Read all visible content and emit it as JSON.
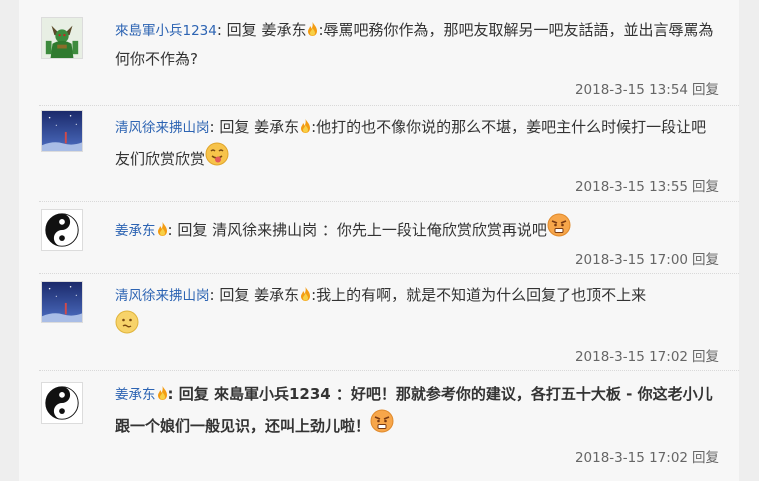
{
  "replies": [
    {
      "username": "來島軍小兵1234",
      "text_a": ": 回复 ",
      "target": "姜承东",
      "text_b": ":辱罵吧務你作為，那吧友取解另一吧友話語，並出言辱罵為何你不作為?",
      "time": "2018-3-15 13:54",
      "reply_label": "回复",
      "avatar_icon": "green-warrior-avatar",
      "emoji_icon": ""
    },
    {
      "username": "清风徐来拂山岗",
      "text_a": ": 回复 ",
      "target": "姜承东",
      "text_b": ":他打的也不像你说的那么不堪，姜吧主什么时候打一段让吧友们欣赏欣赏",
      "time": "2018-3-15 13:55",
      "reply_label": "回复",
      "avatar_icon": "night-sky-avatar",
      "emoji_icon": "tongue-emoji"
    },
    {
      "username": "姜承东",
      "text_a": ": 回复 ",
      "target": "清风徐来拂山岗",
      "text_b": " ：你先上一段让俺欣赏欣赏再说吧",
      "time": "2018-3-15 17:00",
      "reply_label": "回复",
      "avatar_icon": "yin-yang-avatar",
      "emoji_icon": "angry-emoji"
    },
    {
      "username": "清风徐来拂山岗",
      "text_a": ": 回复 ",
      "target": "姜承东",
      "text_b": ":我上的有啊，就是不知道为什么回复了也顶不上来",
      "time": "2018-3-15 17:02",
      "reply_label": "回复",
      "avatar_icon": "night-sky-avatar",
      "emoji_icon": "confused-emoji"
    },
    {
      "username": "姜承东",
      "text_a": ": 回复 ",
      "target": "來島軍小兵1234",
      "text_b": " ：好吧！那就参考你的建议，各打五十大板 - 你这老小儿跟一个娘们一般见识，还叫上劲儿啦！",
      "time": "2018-3-15 17:02",
      "reply_label": "回复",
      "avatar_icon": "yin-yang-avatar",
      "emoji_icon": "angry-emoji"
    }
  ],
  "colors": {
    "link": "#2d64b3",
    "text": "#333333",
    "meta": "#666666",
    "panel": "#f7f7f7"
  }
}
